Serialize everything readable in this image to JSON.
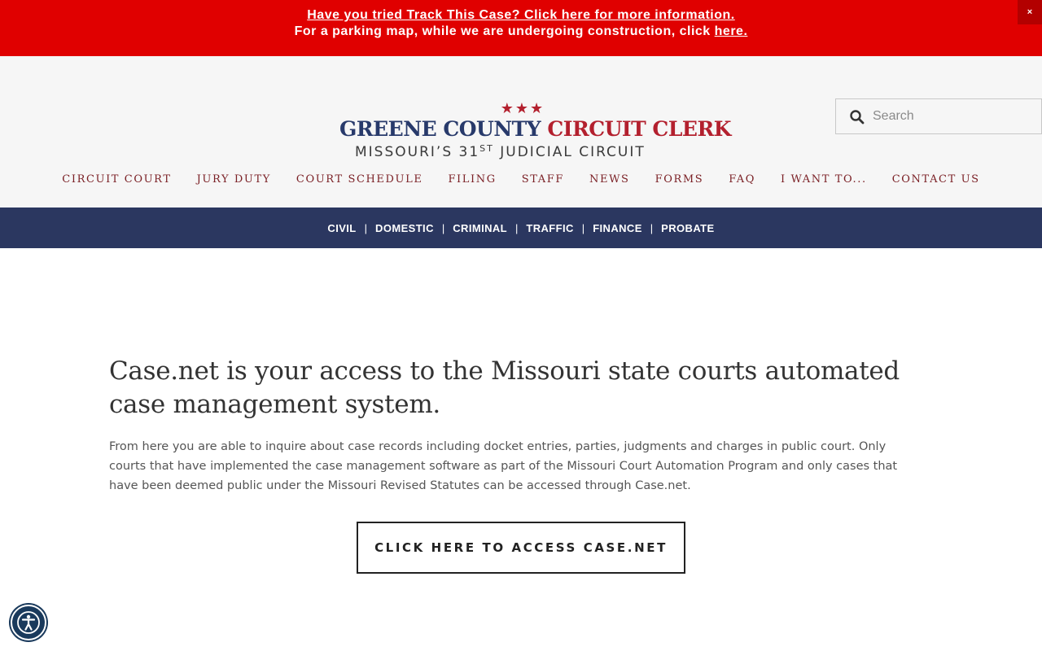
{
  "alert": {
    "line1_link": "Have you tried Track This Case? Click here for more information.",
    "line2_text": "For a parking map, while we are undergoing construction, click",
    "line2_link": "here.",
    "close_label": "×"
  },
  "logo": {
    "stars": "★★★",
    "name_blue": "GREENE COUNTY",
    "name_red": "CIRCUIT CLERK",
    "sub_pre": "MISSOURI’S 31",
    "sub_sup": "ST",
    "sub_post": " JUDICIAL CIRCUIT"
  },
  "search": {
    "placeholder": "Search"
  },
  "main_nav": [
    "CIRCUIT COURT",
    "JURY DUTY",
    "COURT SCHEDULE",
    "FILING",
    "STAFF",
    "NEWS",
    "FORMS",
    "FAQ",
    "I WANT TO...",
    "CONTACT US"
  ],
  "dept_nav": [
    "CIVIL",
    "DOMESTIC",
    "CRIMINAL",
    "TRAFFIC",
    "FINANCE",
    "PROBATE"
  ],
  "dept_separator": "|",
  "content": {
    "heading": "Case.net is your access to the Missouri state courts automated case management system.",
    "body": "From here you are able to inquire about case records including docket entries, parties, judgments and charges in public court. Only courts that have implemented the case management software as part of the Missouri Court Automation Program and only cases that have been deemed public under the Missouri Revised Statutes can be accessed through Case.net.",
    "cta": "CLICK HERE TO ACCESS CASE.NET"
  },
  "colors": {
    "alert_bg": "#e00000",
    "brand_blue": "#283a6b",
    "brand_red": "#b3202e",
    "nav_text": "#7a1f24",
    "dept_bar": "#2b3760"
  },
  "icons": {
    "search": "search-icon",
    "accessibility": "accessibility-icon",
    "close": "close-icon"
  }
}
